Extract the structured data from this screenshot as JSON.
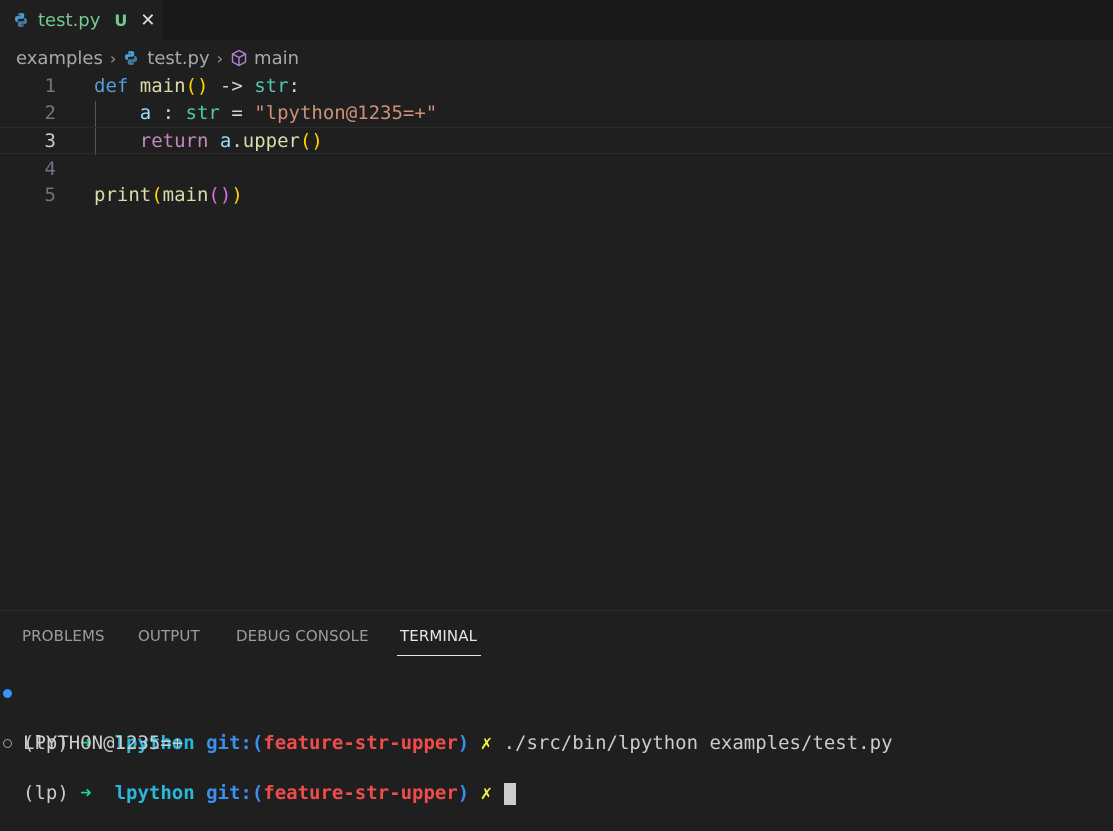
{
  "tab": {
    "title": "test.py",
    "status": "U",
    "close": "✕",
    "icon": "python-icon"
  },
  "breadcrumb": {
    "folder": "examples",
    "file": "test.py",
    "symbol": "main",
    "separator": "›"
  },
  "editor": {
    "line_numbers": [
      "1",
      "2",
      "3",
      "4",
      "5"
    ],
    "active_line": 3,
    "lines": [
      [
        {
          "t": "def",
          "c": "kw"
        },
        {
          "t": " "
        },
        {
          "t": "main",
          "c": "fn"
        },
        {
          "t": "()",
          "c": "b1"
        },
        {
          "t": " -> ",
          "c": "op"
        },
        {
          "t": "str",
          "c": "type"
        },
        {
          "t": ":",
          "c": "op"
        }
      ],
      [
        {
          "t": "    "
        },
        {
          "t": "a",
          "c": "var"
        },
        {
          "t": " : ",
          "c": "op"
        },
        {
          "t": "str",
          "c": "type"
        },
        {
          "t": " = ",
          "c": "op"
        },
        {
          "t": "\"lpython@1235=+\"",
          "c": "str"
        }
      ],
      [
        {
          "t": "    "
        },
        {
          "t": "return",
          "c": "ctrl"
        },
        {
          "t": " "
        },
        {
          "t": "a",
          "c": "var"
        },
        {
          "t": ".",
          "c": "op"
        },
        {
          "t": "upper",
          "c": "fn"
        },
        {
          "t": "()",
          "c": "b1"
        }
      ],
      [],
      [
        {
          "t": "print",
          "c": "fn"
        },
        {
          "t": "(",
          "c": "b1"
        },
        {
          "t": "main",
          "c": "fn"
        },
        {
          "t": "()",
          "c": "b2"
        },
        {
          "t": ")",
          "c": "b1"
        }
      ]
    ]
  },
  "panel": {
    "tabs": [
      "PROBLEMS",
      "OUTPUT",
      "DEBUG CONSOLE",
      "TERMINAL"
    ],
    "active_tab": "TERMINAL"
  },
  "terminal": {
    "prompt_env": "(lp)",
    "prompt_arrow": "➜",
    "prompt_dir": "lpython",
    "git_label": "git:(",
    "branch": "feature-str-upper",
    "git_close": ")",
    "dirty_mark": "✗",
    "command": "./src/bin/lpython examples/test.py",
    "output": "LPYTHON@1235=+"
  },
  "colors": {
    "background": "#1f1f1f",
    "tab_modified": "#73c991",
    "prompt_arrow": "#23d18b",
    "prompt_dir": "#29b8db",
    "branch": "#f14c4c",
    "dirty": "#f5f543"
  }
}
